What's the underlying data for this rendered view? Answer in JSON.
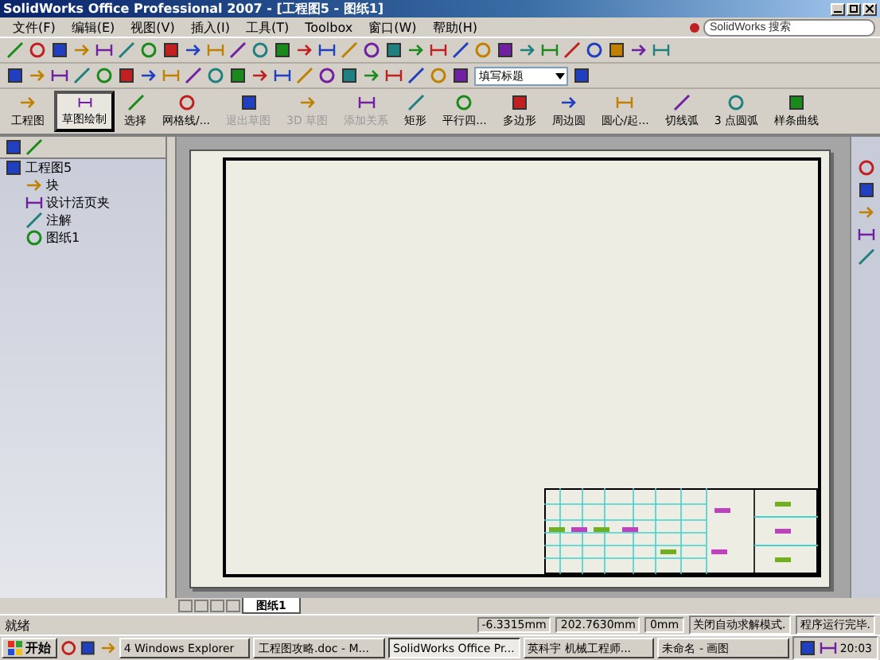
{
  "window": {
    "title": "SolidWorks Office Professional 2007 - [工程图5 - 图纸1]"
  },
  "menu": [
    "文件(F)",
    "编辑(E)",
    "视图(V)",
    "插入(I)",
    "工具(T)",
    "Toolbox",
    "窗口(W)",
    "帮助(H)"
  ],
  "search": {
    "placeholder": "SolidWorks 搜索"
  },
  "layer_combo": {
    "value": "填写标题"
  },
  "command_tabs": [
    {
      "label": "工程图",
      "selected": false
    },
    {
      "label": "草图绘制",
      "selected": true
    }
  ],
  "commands": [
    {
      "label": "选择",
      "disabled": false
    },
    {
      "label": "网格线/...",
      "disabled": false
    },
    {
      "label": "退出草图",
      "disabled": true
    },
    {
      "label": "3D 草图",
      "disabled": true
    },
    {
      "label": "添加关系",
      "disabled": true
    },
    {
      "label": "矩形",
      "disabled": false
    },
    {
      "label": "平行四...",
      "disabled": false
    },
    {
      "label": "多边形",
      "disabled": false
    },
    {
      "label": "周边圆",
      "disabled": false
    },
    {
      "label": "圆心/起...",
      "disabled": false
    },
    {
      "label": "切线弧",
      "disabled": false
    },
    {
      "label": "3 点圆弧",
      "disabled": false
    },
    {
      "label": "样条曲线",
      "disabled": false
    }
  ],
  "tree": {
    "root": "工程图5",
    "children": [
      {
        "label": "块"
      },
      {
        "label": "设计活页夹"
      },
      {
        "label": "注解"
      },
      {
        "label": "图纸1"
      }
    ]
  },
  "sheet_tabs": [
    {
      "label": "图纸1",
      "selected": true
    }
  ],
  "status_bar": {
    "message": "就绪",
    "fields": [
      "-6.3315mm",
      "202.7630mm",
      "0mm",
      "关闭自动求解模式.",
      "程序运行完毕."
    ]
  },
  "taskbar": {
    "start": "开始",
    "items": [
      {
        "label": "4 Windows Explorer",
        "selected": false
      },
      {
        "label": "工程图攻略.doc - M...",
        "selected": false
      },
      {
        "label": "SolidWorks Office Pr...",
        "selected": true
      },
      {
        "label": "英科宇 机械工程师...",
        "selected": false
      },
      {
        "label": "未命名 - 画图",
        "selected": false
      }
    ],
    "clock": "20:03"
  }
}
